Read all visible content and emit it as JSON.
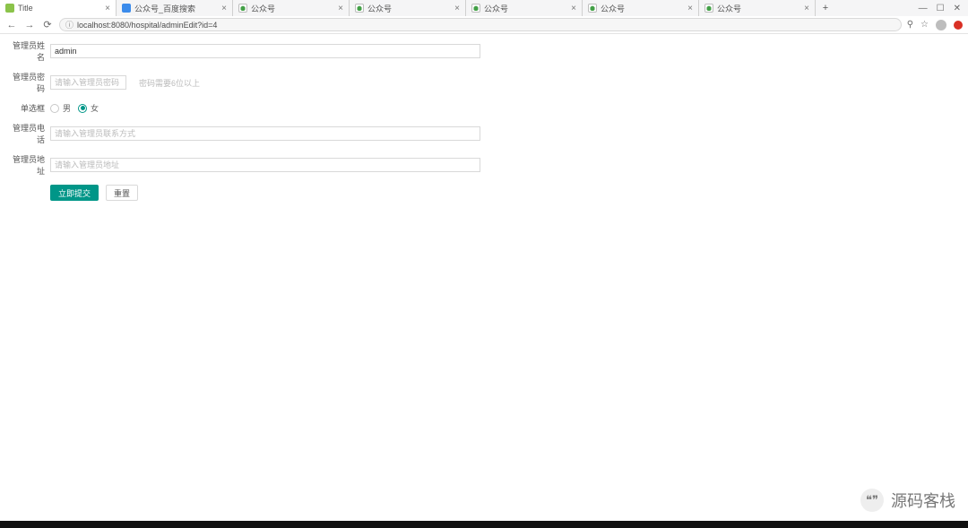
{
  "browser": {
    "tabs": [
      {
        "title": "Title",
        "favicon": "leaf",
        "active": true
      },
      {
        "title": "公众号_百度搜索",
        "favicon": "gear",
        "active": false
      },
      {
        "title": "公众号",
        "favicon": "cloud",
        "active": false
      },
      {
        "title": "公众号",
        "favicon": "cloud",
        "active": false
      },
      {
        "title": "公众号",
        "favicon": "cloud",
        "active": false
      },
      {
        "title": "公众号",
        "favicon": "cloud",
        "active": false
      },
      {
        "title": "公众号",
        "favicon": "cloud",
        "active": false
      }
    ],
    "url": "localhost:8080/hospital/adminEdit?id=4",
    "newtab_symbol": "+",
    "win": {
      "min": "—",
      "max": "☐",
      "close": "✕"
    },
    "nav": {
      "back": "←",
      "forward": "→",
      "reload": "⟳",
      "info": "ⓘ",
      "search": "⚲",
      "star": "☆"
    }
  },
  "form": {
    "name": {
      "label": "管理员姓名",
      "value": "admin"
    },
    "password": {
      "label": "管理员密码",
      "placeholder": "请输入管理员密码",
      "hint": "密码需要6位以上"
    },
    "gender": {
      "label": "单选框",
      "options": [
        {
          "text": "男",
          "selected": false
        },
        {
          "text": "女",
          "selected": true
        }
      ]
    },
    "phone": {
      "label": "管理员电话",
      "placeholder": "请输入管理员联系方式"
    },
    "address": {
      "label": "管理员地址",
      "placeholder": "请输入管理员地址"
    },
    "actions": {
      "submit": "立即提交",
      "reset": "重置"
    }
  },
  "watermark": {
    "icon": "❝❞",
    "text": "源码客栈"
  }
}
